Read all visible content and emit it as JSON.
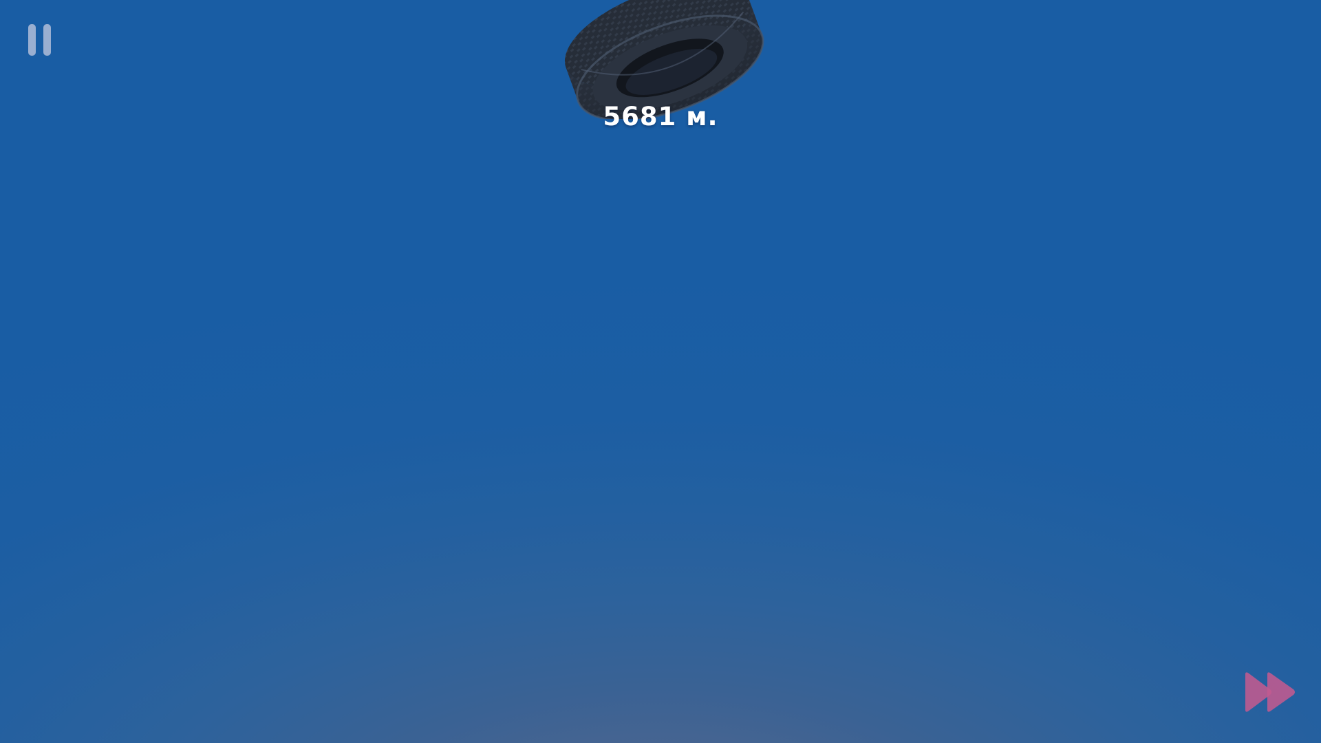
{
  "hud": {
    "distance_text": "5681 м.",
    "pause_icon": "pause-icon",
    "fast_forward_icon": "fast-forward-icon"
  },
  "colors": {
    "sky_top": "#195da4",
    "sky_glow": "#596a8e",
    "pause_icon": "#a9b8d6",
    "fast_forward": "#c15a8f",
    "tire": "#252c37"
  }
}
